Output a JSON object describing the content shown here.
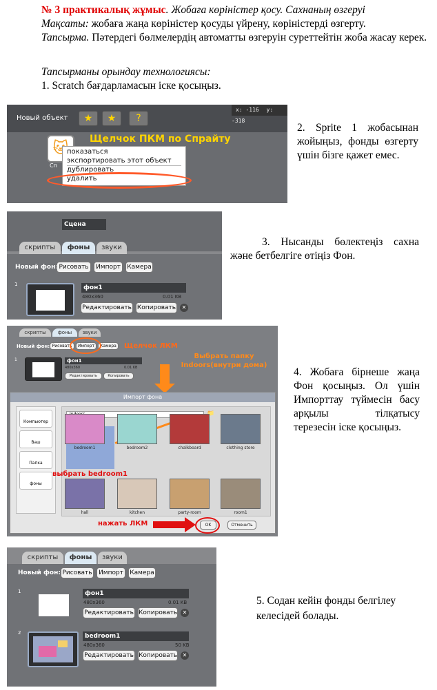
{
  "header": {
    "title_bold": "№ 3 практикалық жұмыс",
    "title_rest": ". Жобаға көріністер қосу. Сахнаның өзгеруі",
    "aim_label": "Мақсаты:",
    "aim_text": " жобаға жаңа көріністер қосуды үйрену, көріністерді өзгерту.",
    "task_label": "Тапсырма.",
    "task_text": " Пәтердегі бөлмелердің автоматты өзгеруін суреттейтін жоба жасау керек.",
    "tech_label": "Тапсырманы орындау технологиясы:",
    "step1": "1. Scratch бағдарламасын іске қосыңыз."
  },
  "steps": {
    "step2": "2. Sprite 1 жобасынан жойыңыз, фонды өзгерту үшін бізге қажет емес.",
    "step3": "3. Нысанды бөлектеңіз сахна және бетбелгіге өтіңіз Фон.",
    "step4": "4. Жобаға бірнеше жаңа Фон қосыңыз. Ол үшін Импорттау түймесін басу арқылы тілқатысу терезесін іске қосыңыз.",
    "step5": "5. Содан кейін фонды белгілеу келесідей болады."
  },
  "shot1": {
    "new_object": "Новый объект",
    "coords_x": "x: -116",
    "coords_y": "y: -318",
    "annotation": "Щелчок ПКМ по Спрайту",
    "sprite_label": "Сп",
    "menu": [
      "показаться",
      "экспортировать этот объект",
      "дублировать",
      "удалить"
    ]
  },
  "shot2": {
    "stage_name": "Сцена",
    "tabs": [
      "скрипты",
      "фоны",
      "звуки"
    ],
    "new_bg": "Новый фон:",
    "buttons": [
      "Рисовать",
      "Импорт",
      "Камера"
    ],
    "item_num": "1",
    "bg_name": "фон1",
    "bg_size": "480x360",
    "bg_kb": "0.01 KB",
    "edit": "Редактировать",
    "copy": "Копировать"
  },
  "shot3": {
    "tabs": [
      "скрипты",
      "фоны",
      "звуки"
    ],
    "new_bg": "Новый фон:",
    "buttons": [
      "Рисовать",
      "Импорт",
      "Камера"
    ],
    "annot_click": "Щелчок ЛКМ",
    "annot_folder": "Выбрать папку Indoors(внутри дома)",
    "annot_bedroom": "выбрать bedroom1",
    "annot_ok": "нажать ЛКМ",
    "dialog_title": "Импорт фона",
    "folder": "Indoors",
    "side": [
      "Компьютер",
      "Ваш",
      "Папка",
      "фоны"
    ],
    "files": [
      "bedroom1",
      "bedroom2",
      "chalkboard",
      "clothing store",
      "hall",
      "kitchen",
      "party-room",
      "room1"
    ],
    "ok": "OK",
    "cancel": "Отменить",
    "item_num": "1",
    "bg_name": "фон1",
    "bg_size": "480x360",
    "bg_kb": "0.01 KB",
    "edit": "Редактировать",
    "copy": "Копировать"
  },
  "shot4": {
    "tabs": [
      "скрипты",
      "фоны",
      "звуки"
    ],
    "new_bg": "Новый фон:",
    "buttons": [
      "Рисовать",
      "Импорт",
      "Камера"
    ],
    "items": [
      {
        "num": "1",
        "name": "фон1",
        "size": "480x360",
        "kb": "0.01 KB"
      },
      {
        "num": "2",
        "name": "bedroom1",
        "size": "480x360",
        "kb": "50 KB"
      }
    ],
    "edit": "Редактировать",
    "copy": "Копировать"
  },
  "colors": {
    "title_red": "#e00000",
    "annotation_yellow": "#ffd400",
    "annotation_orange": "#ff6a1a",
    "annotation_red": "#e01010"
  }
}
